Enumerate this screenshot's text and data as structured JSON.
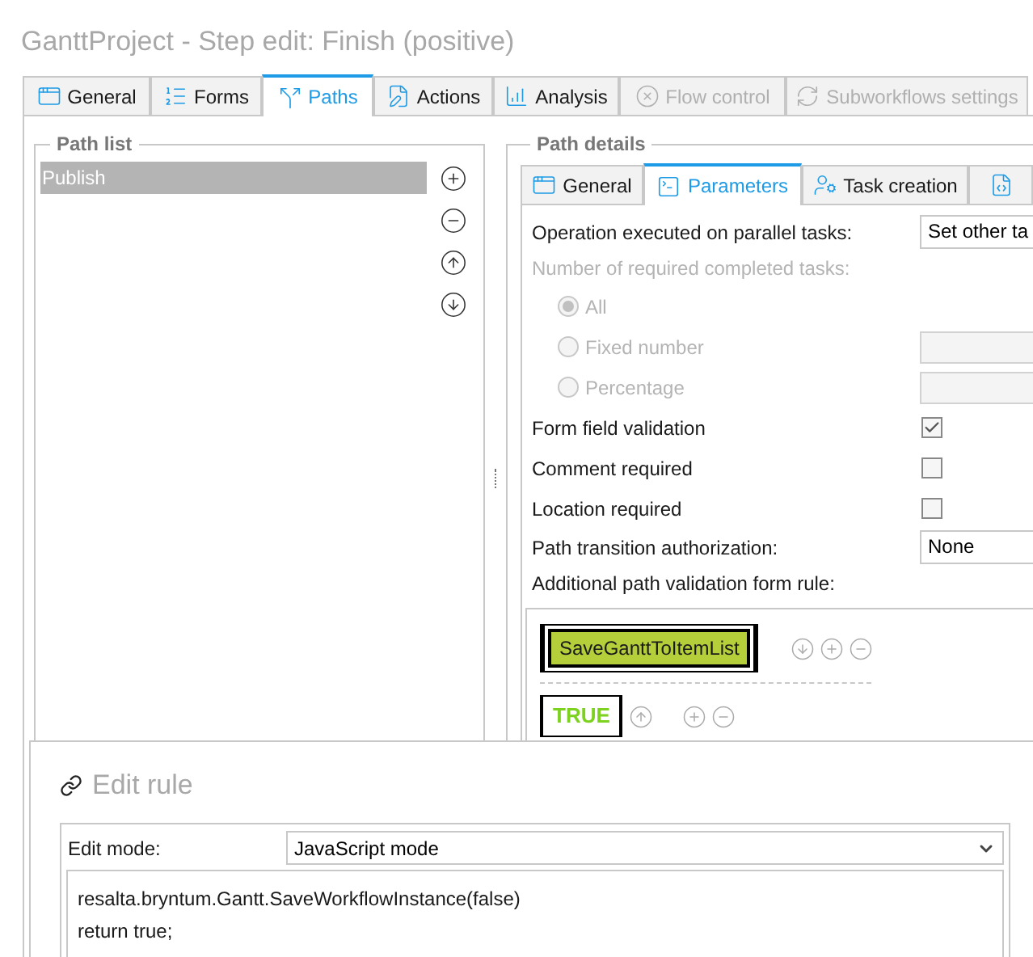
{
  "window": {
    "title": "GanttProject - Step edit: Finish (positive)"
  },
  "tabs": [
    {
      "label": "General",
      "selected": false,
      "disabled": false
    },
    {
      "label": "Forms",
      "selected": false,
      "disabled": false
    },
    {
      "label": "Paths",
      "selected": true,
      "disabled": false
    },
    {
      "label": "Actions",
      "selected": false,
      "disabled": false
    },
    {
      "label": "Analysis",
      "selected": false,
      "disabled": false
    },
    {
      "label": "Flow control",
      "selected": false,
      "disabled": true
    },
    {
      "label": "Subworkflows settings",
      "selected": false,
      "disabled": true
    }
  ],
  "path_list": {
    "title": "Path list",
    "items": [
      {
        "label": "Publish",
        "selected": true
      }
    ]
  },
  "path_details": {
    "title": "Path details",
    "tabs": [
      {
        "label": "General",
        "selected": false
      },
      {
        "label": "Parameters",
        "selected": true
      },
      {
        "label": "Task creation",
        "selected": false
      },
      {
        "selected": false
      }
    ],
    "rows": [
      {
        "kind": "select",
        "label": "Operation executed on parallel tasks:",
        "value": "Set other ta"
      },
      {
        "kind": "caption",
        "label": "Number of required completed tasks:",
        "disabled": true
      },
      {
        "kind": "radio",
        "label": "All",
        "selected": true,
        "disabled": true,
        "field": false
      },
      {
        "kind": "radio",
        "label": "Fixed number",
        "selected": false,
        "disabled": true,
        "field": true
      },
      {
        "kind": "radio",
        "label": "Percentage",
        "selected": false,
        "disabled": true,
        "field": true
      },
      {
        "kind": "checkbox",
        "label": "Form field validation",
        "checked": true
      },
      {
        "kind": "checkbox",
        "label": "Comment required",
        "checked": false
      },
      {
        "kind": "checkbox",
        "label": "Location required",
        "checked": false
      },
      {
        "kind": "select",
        "label": "Path transition authorization:",
        "value": "None"
      },
      {
        "kind": "caption",
        "label": "Additional path validation form rule:",
        "disabled": false
      }
    ],
    "rule_blocks": [
      {
        "kind": "function",
        "label": "SaveGanttToItemList"
      },
      {
        "kind": "constant",
        "label": "TRUE"
      }
    ]
  },
  "edit_rule": {
    "title": "Edit rule",
    "mode_label": "Edit mode:",
    "mode_value": "JavaScript mode",
    "code": [
      "resalta.bryntum.Gantt.SaveWorkflowInstance(false)",
      "return true;"
    ]
  }
}
